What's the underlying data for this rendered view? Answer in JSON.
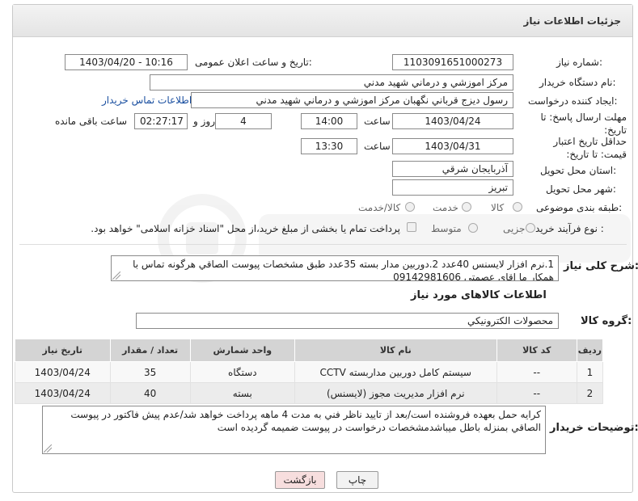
{
  "header": {
    "title": "جزئیات اطلاعات نیاز"
  },
  "form": {
    "need_number": {
      "label": "شماره نیاز:",
      "value": "1103091651000273"
    },
    "announce_datetime": {
      "label": "تاریخ و ساعت اعلان عمومی:",
      "value": "1403/04/20 - 10:16"
    },
    "buyer_org": {
      "label": "نام دستگاه خریدار:",
      "value": "مرکز اموزشي و درماني شهيد مدني"
    },
    "requester": {
      "label": "ایجاد کننده درخواست:",
      "value": "رسول ديزج قرباني نگهبان مرکز اموزشي و درماني شهيد مدني",
      "contact_link": "اطلاعات تماس خریدار"
    },
    "send_deadline": {
      "label": "مهلت ارسال پاسخ: تا تاریخ:",
      "date": "1403/04/24",
      "time_label": "ساعت",
      "time": "14:00",
      "days": "4",
      "days_label": "روز و",
      "remaining": "02:27:17",
      "remaining_label": "ساعت باقی مانده"
    },
    "price_validity": {
      "label": "حداقل تاریخ اعتبار قیمت: تا تاریخ:",
      "date": "1403/04/31",
      "time_label": "ساعت",
      "time": "13:30"
    },
    "province": {
      "label": "استان محل تحویل:",
      "value": "آذربايجان شرقي"
    },
    "city": {
      "label": "شهر محل تحویل:",
      "value": "تبريز"
    },
    "category": {
      "label": "طبقه بندی موضوعی:",
      "options": [
        "کالا",
        "خدمت",
        "کالا/خدمت"
      ]
    },
    "process_type": {
      "label": "نوع فرآیند خرید :",
      "options": [
        "جزیی",
        "متوسط"
      ],
      "payment_note": "پرداخت تمام یا بخشی از مبلغ خرید،از محل \"اسناد خزانه اسلامی\" خواهد بود."
    },
    "description": {
      "label": "شرح کلی نیاز:",
      "value": "1.نرم افزار لايسنس 40عدد 2.دوربين مدار بسته 35عدد طبق مشخصات پيوست الصاقي هرگونه تماس با همکار ما اقاي عصمتي 09142981606"
    }
  },
  "goods_section": {
    "title": "اطلاعات کالاهای مورد نیاز",
    "group_label": "گروه کالا:",
    "group_value": "محصولات الکترونيکي",
    "columns": [
      "ردیف",
      "کد کالا",
      "نام کالا",
      "واحد شمارش",
      "تعداد / مقدار",
      "تاریخ نیاز"
    ],
    "rows": [
      [
        "1",
        "--",
        "سيستم کامل دوربين مداربسته CCTV",
        "دستگاه",
        "35",
        "1403/04/24"
      ],
      [
        "2",
        "--",
        "نرم افزار مديريت مجوز (لايسنس)",
        "بسته",
        "40",
        "1403/04/24"
      ]
    ]
  },
  "buyer_notes": {
    "label": "توضیحات خریدار:",
    "value": "کرايه حمل بعهده فروشنده است/بعد از تاييد ناظر فني به مدت 4 ماهه پرداخت خواهد شد/عدم پيش فاکتور  در پيوست الصاقي بمنزله باطل ميباشدمشخصات درخواست در پيوست ضميمه گرديده است"
  },
  "buttons": {
    "print": "چاپ",
    "back": "بازگشت"
  },
  "colors": {
    "link": "#1a4fa0",
    "print_bg": "#f2f2f2",
    "back_bg": "#f7dede"
  }
}
